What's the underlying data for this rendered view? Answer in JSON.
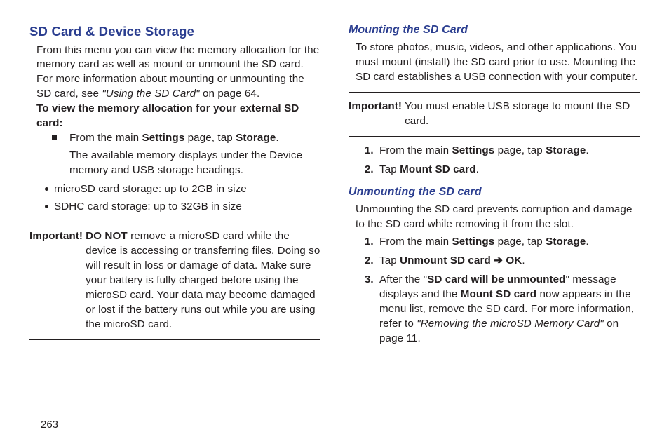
{
  "page_number": "263",
  "left": {
    "heading": "SD Card & Device Storage",
    "p1": "From this menu you can view the memory allocation for the memory card as well as mount or unmount the SD card.",
    "p2a": "For more information about mounting or unmounting the SD card, see ",
    "p2b": "\"Using the SD Card\"",
    "p2c": " on page 64.",
    "instr_head": "To view the memory allocation for your external SD card:",
    "sq_a": "From the main ",
    "sq_b": "Settings",
    "sq_c": " page, tap ",
    "sq_d": "Storage",
    "sq_e": ".",
    "sq_line2": "The available memory displays under the Device memory and USB storage headings.",
    "dot1": "microSD card storage: up to 2GB in size",
    "dot2": "SDHC card storage: up to 32GB in size",
    "imp_label": "Important! ",
    "imp_bold": "DO NOT",
    "imp_rest": " remove a microSD card while the device is accessing or transferring files. Doing so will result in loss or damage of data. Make sure your battery is fully charged before using the microSD card. Your data may become damaged or lost if the battery runs out while you are using the microSD card."
  },
  "right": {
    "mount_head": "Mounting the SD Card",
    "mount_p1": "To store photos, music, videos, and other applications. You must mount (install) the SD card prior to use. Mounting the SD card establishes a USB connection with your computer.",
    "mount_imp_label": "Important!",
    "mount_imp_text": " You must enable USB storage to mount the SD card.",
    "m1a": "From the main ",
    "m1b": "Settings",
    "m1c": " page, tap ",
    "m1d": "Storage",
    "m1e": ".",
    "m2a": "Tap ",
    "m2b": "Mount SD card",
    "m2c": ".",
    "unmount_head": "Unmounting the SD card",
    "unmount_p1": "Unmounting the SD card prevents corruption and damage to the SD card while removing it from the slot.",
    "u1a": "From the main ",
    "u1b": "Settings",
    "u1c": " page, tap ",
    "u1d": "Storage",
    "u1e": ".",
    "u2a": "Tap ",
    "u2b": "Unmount SD card",
    "u2arrow": " ➔ ",
    "u2c": "OK",
    "u2d": ".",
    "u3a": "After the \"",
    "u3b": "SD card will be unmounted",
    "u3c": "\" message displays and the ",
    "u3d": "Mount SD card",
    "u3e": " now appears in the menu list, remove the SD card. For more information, refer to ",
    "u3f": "\"Removing the microSD Memory Card\"",
    "u3g": "  on page 11."
  }
}
